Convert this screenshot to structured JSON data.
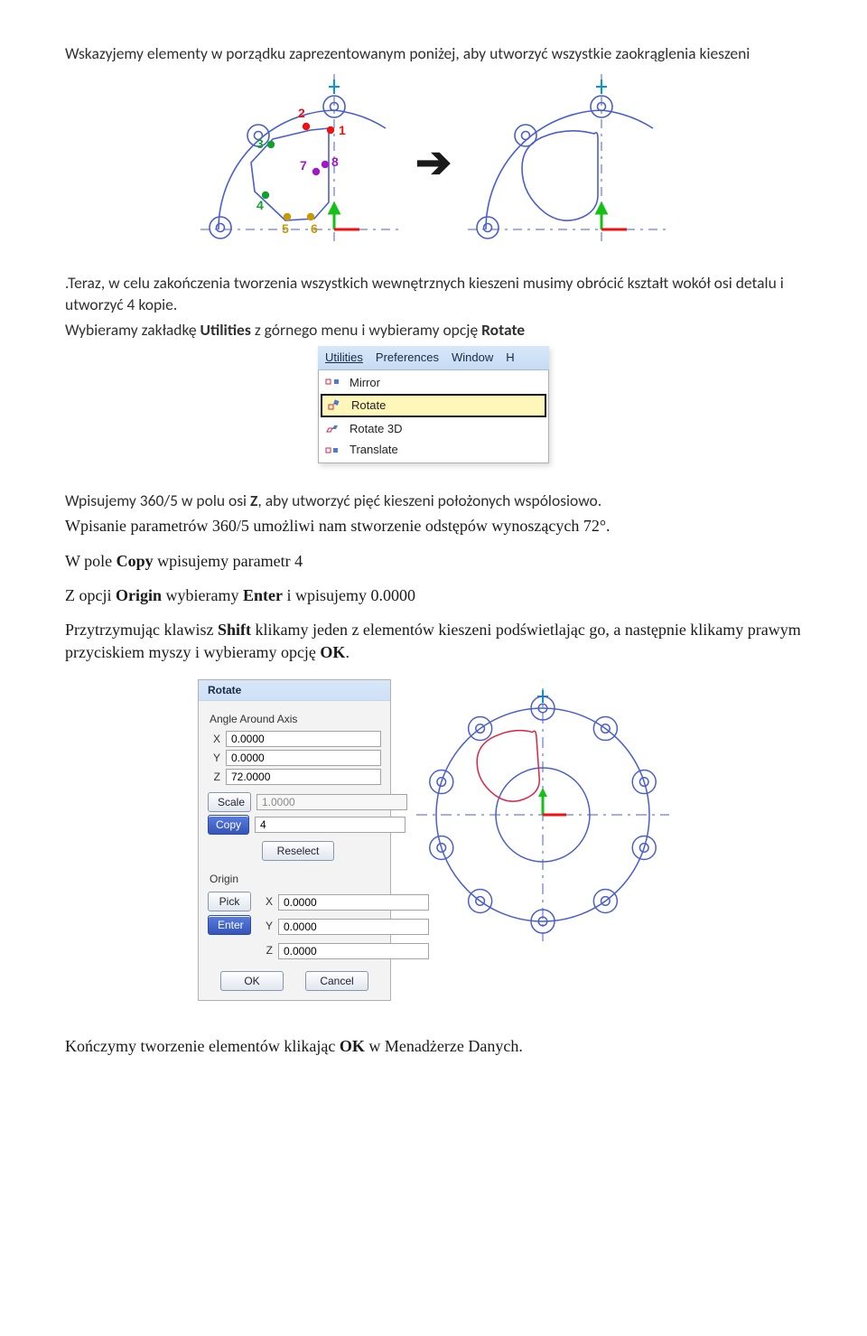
{
  "para1a": "Wskazyjemy elementy w porządku zaprezentowanym poniżej, aby utworzyć wszystkie zaokrąglenia kieszeni",
  "para2a": ".Teraz, w celu zakończenia tworzenia wszystkich wewnętrznych kieszeni musimy obrócić kształt wokół osi detalu i utworzyć 4 kopie.",
  "para3": {
    "pre": "Wybieramy zakładkę ",
    "b1": "Utilities",
    "mid": " z górnego menu i wybieramy opcję ",
    "b2": "Rotate"
  },
  "para4": {
    "pre": "Wpisujemy 360/5 w polu osi ",
    "b": "Z",
    "suf": ", aby utworzyć pięć kieszeni położonych wspólosiowo."
  },
  "para5": "Wpisanie parametrów 360/5 umożliwi nam stworzenie odstępów wynoszących 72°.",
  "para6": {
    "pre": "W pole ",
    "b": "Copy",
    "suf": " wpisujemy parametr 4"
  },
  "para7": {
    "pre": "Z opcji ",
    "b1": "Origin",
    "mid": " wybieramy ",
    "b2": "Enter",
    "suf": " i wpisujemy 0.0000"
  },
  "para8": {
    "pre": "Przytrzymując klawisz ",
    "b1": "Shift",
    "mid": " klikamy jeden z elementów kieszeni podświetlając go, a następnie klikamy prawym przyciskiem myszy i wybieramy opcję ",
    "b2": "OK",
    "suf": "."
  },
  "para9": {
    "pre": "Kończymy tworzenie elementów klikając ",
    "b": "OK",
    "suf": " w Menadżerze Danych."
  },
  "fig1": {
    "labels": [
      "1",
      "2",
      "3",
      "4",
      "5",
      "6",
      "7",
      "8"
    ]
  },
  "menu": {
    "bar": [
      "Utilities",
      "Preferences",
      "Window",
      "H"
    ],
    "items": [
      "Mirror",
      "Rotate",
      "Rotate 3D",
      "Translate"
    ],
    "selected_index": 1
  },
  "panel": {
    "title": "Rotate",
    "angle_label": "Angle Around Axis",
    "axes": [
      "X",
      "Y",
      "Z"
    ],
    "angle_values": [
      "0.0000",
      "0.0000",
      "72.0000"
    ],
    "scale_label": "Scale",
    "scale_value": "1.0000",
    "copy_label": "Copy",
    "copy_value": "4",
    "reselect": "Reselect",
    "origin_label": "Origin",
    "pick": "Pick",
    "enter": "Enter",
    "origin_values": [
      "0.0000",
      "0.0000",
      "0.0000"
    ],
    "ok": "OK",
    "cancel": "Cancel"
  }
}
